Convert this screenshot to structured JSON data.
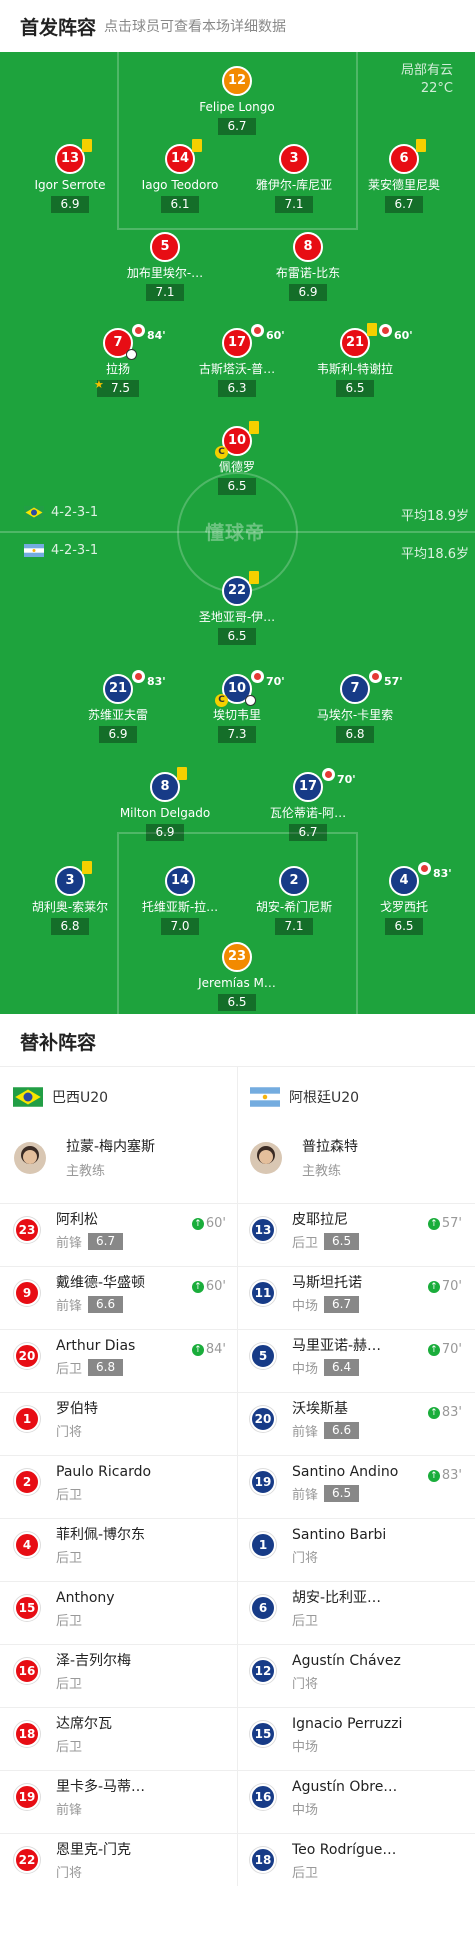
{
  "header": {
    "title": "首发阵容",
    "subtitle": "点击球员可查看本场详细数据"
  },
  "pitch": {
    "weather": "局部有云",
    "temperature": "22°C",
    "watermark": "懂球帝",
    "home": {
      "formation": "4-2-3-1",
      "avg_age": "平均18.9岁"
    },
    "away": {
      "formation": "4-2-3-1",
      "avg_age": "平均18.6岁"
    }
  },
  "home_players": [
    {
      "num": "12",
      "name": "Felipe Longo",
      "rating": "6.7",
      "color": "org"
    },
    {
      "num": "13",
      "name": "Igor Serrote",
      "rating": "6.9",
      "color": "red",
      "yellow": true,
      "ball": true
    },
    {
      "num": "14",
      "name": "Iago Teodoro",
      "rating": "6.1",
      "color": "red",
      "yellow": true
    },
    {
      "num": "3",
      "name": "雅伊尔-库尼亚",
      "rating": "7.1",
      "color": "red"
    },
    {
      "num": "6",
      "name": "莱安德里尼奥",
      "rating": "6.7",
      "color": "red",
      "yellow": true
    },
    {
      "num": "5",
      "name": "加布里埃尔-…",
      "rating": "7.1",
      "color": "red"
    },
    {
      "num": "8",
      "name": "布雷诺-比东",
      "rating": "6.9",
      "color": "red"
    },
    {
      "num": "7",
      "name": "拉扬",
      "rating": "7.5",
      "color": "red",
      "sub": "84'",
      "goal": true,
      "star": true
    },
    {
      "num": "17",
      "name": "古斯塔沃-普…",
      "rating": "6.3",
      "color": "red",
      "sub": "60'"
    },
    {
      "num": "21",
      "name": "韦斯利-特谢拉",
      "rating": "6.5",
      "color": "red",
      "sub": "60'",
      "yellow": true
    },
    {
      "num": "10",
      "name": "佩德罗",
      "rating": "6.5",
      "color": "red",
      "yellow": true,
      "captain": true
    }
  ],
  "away_players": [
    {
      "num": "22",
      "name": "圣地亚哥-伊…",
      "rating": "6.5",
      "color": "blue",
      "yellow": true
    },
    {
      "num": "21",
      "name": "苏维亚夫雷",
      "rating": "6.9",
      "color": "blue",
      "sub": "83'"
    },
    {
      "num": "10",
      "name": "埃切韦里",
      "rating": "7.3",
      "color": "blue",
      "sub": "70'",
      "captain": true,
      "goal": true
    },
    {
      "num": "7",
      "name": "马埃尔-卡里索",
      "rating": "6.8",
      "color": "blue",
      "sub": "57'"
    },
    {
      "num": "8",
      "name": "Milton Delgado",
      "rating": "6.9",
      "color": "blue",
      "yellow": true
    },
    {
      "num": "17",
      "name": "瓦伦蒂诺-阿…",
      "rating": "6.7",
      "color": "blue",
      "sub": "70'"
    },
    {
      "num": "3",
      "name": "胡利奥-索莱尔",
      "rating": "6.8",
      "color": "blue",
      "yellow": true
    },
    {
      "num": "14",
      "name": "托维亚斯-拉…",
      "rating": "7.0",
      "color": "blue"
    },
    {
      "num": "2",
      "name": "胡安-希门尼斯",
      "rating": "7.1",
      "color": "blue"
    },
    {
      "num": "4",
      "name": "戈罗西托",
      "rating": "6.5",
      "color": "blue",
      "sub": "83'"
    },
    {
      "num": "23",
      "name": "Jeremías M…",
      "rating": "6.5",
      "color": "org"
    }
  ],
  "subs": {
    "title": "替补阵容",
    "home": {
      "team": "巴西U20",
      "coach_name": "拉蒙-梅内塞斯",
      "coach_role": "主教练",
      "players": [
        {
          "num": "23",
          "name": "阿利松",
          "pos": "前锋",
          "rating": "6.7",
          "in": "60'"
        },
        {
          "num": "9",
          "name": "戴维德-华盛顿",
          "pos": "前锋",
          "rating": "6.6",
          "in": "60'"
        },
        {
          "num": "20",
          "name": "Arthur Dias",
          "pos": "后卫",
          "rating": "6.8",
          "in": "84'"
        },
        {
          "num": "1",
          "name": "罗伯特",
          "pos": "门将"
        },
        {
          "num": "2",
          "name": "Paulo Ricardo",
          "pos": "后卫"
        },
        {
          "num": "4",
          "name": "菲利佩-博尔东",
          "pos": "后卫"
        },
        {
          "num": "15",
          "name": "Anthony",
          "pos": "后卫"
        },
        {
          "num": "16",
          "name": "泽-吉列尔梅",
          "pos": "后卫"
        },
        {
          "num": "18",
          "name": "达席尔瓦",
          "pos": "后卫"
        },
        {
          "num": "19",
          "name": "里卡多-马蒂…",
          "pos": "前锋"
        },
        {
          "num": "22",
          "name": "恩里克-门克",
          "pos": "门将"
        }
      ]
    },
    "away": {
      "team": "阿根廷U20",
      "coach_name": "普拉森特",
      "coach_role": "主教练",
      "players": [
        {
          "num": "13",
          "name": "皮耶拉尼",
          "pos": "后卫",
          "rating": "6.5",
          "in": "57'"
        },
        {
          "num": "11",
          "name": "马斯坦托诺",
          "pos": "中场",
          "rating": "6.7",
          "in": "70'"
        },
        {
          "num": "5",
          "name": "马里亚诺-赫…",
          "pos": "中场",
          "rating": "6.4",
          "in": "70'"
        },
        {
          "num": "20",
          "name": "沃埃斯基",
          "pos": "前锋",
          "rating": "6.6",
          "in": "83'"
        },
        {
          "num": "19",
          "name": "Santino Andino",
          "pos": "前锋",
          "rating": "6.5",
          "in": "83'"
        },
        {
          "num": "1",
          "name": "Santino Barbi",
          "pos": "门将"
        },
        {
          "num": "6",
          "name": "胡安-比利亚…",
          "pos": "后卫"
        },
        {
          "num": "12",
          "name": "Agustín Chávez",
          "pos": "门将"
        },
        {
          "num": "15",
          "name": "Ignacio Perruzzi",
          "pos": "中场"
        },
        {
          "num": "16",
          "name": "Agustín Obre…",
          "pos": "中场"
        },
        {
          "num": "18",
          "name": "Teo Rodrígue…",
          "pos": "后卫"
        }
      ]
    }
  },
  "colors": {
    "pitch": "#1ea33d",
    "home": "#e70d14",
    "away": "#173b87",
    "keeper": "#f28a00"
  }
}
